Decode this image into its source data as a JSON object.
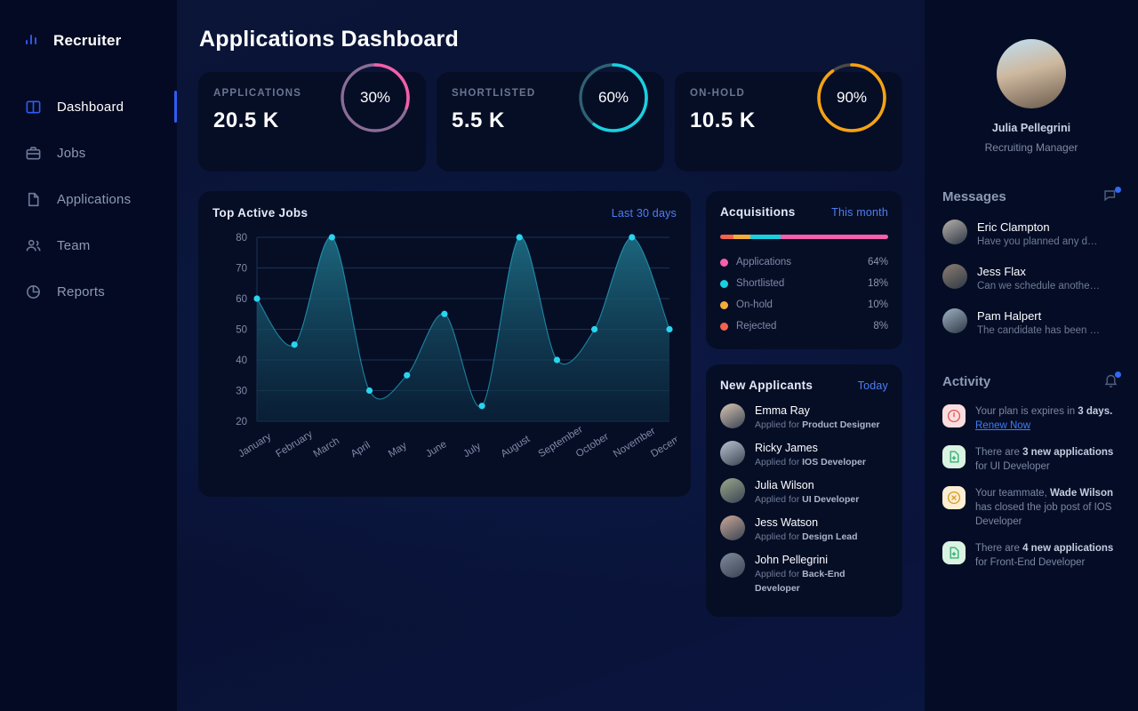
{
  "sidebar": {
    "brand": {
      "label": "Recruiter",
      "icon": "bar-chart-icon"
    },
    "items": [
      {
        "label": "Dashboard",
        "icon": "dashboard-icon",
        "active": true
      },
      {
        "label": "Jobs",
        "icon": "briefcase-icon",
        "active": false
      },
      {
        "label": "Applications",
        "icon": "document-icon",
        "active": false
      },
      {
        "label": "Team",
        "icon": "users-icon",
        "active": false
      },
      {
        "label": "Reports",
        "icon": "pie-chart-icon",
        "active": false
      }
    ]
  },
  "header": {
    "title": "Applications Dashboard"
  },
  "stats": [
    {
      "label": "APPLICATIONS",
      "value": "20.5 K",
      "percent_label": "30%",
      "percent": 30,
      "color": "#f25fa8",
      "track": "#8a6d96"
    },
    {
      "label": "SHORTLISTED",
      "value": "5.5 K",
      "percent_label": "60%",
      "percent": 60,
      "color": "#1ad0e0",
      "track": "#2d6273"
    },
    {
      "label": "ON-HOLD",
      "value": "10.5 K",
      "percent_label": "90%",
      "percent": 90,
      "color": "#f5a213",
      "track": "#4a4a46"
    }
  ],
  "chart_panel": {
    "title": "Top Active Jobs",
    "action": "Last 30 days"
  },
  "chart_data": {
    "type": "area",
    "title": "Top Active Jobs",
    "xlabel": "",
    "ylabel": "",
    "categories": [
      "January",
      "February",
      "March",
      "April",
      "May",
      "June",
      "July",
      "August",
      "September",
      "October",
      "November",
      "December"
    ],
    "values": [
      60,
      45,
      80,
      30,
      35,
      55,
      25,
      80,
      40,
      50,
      80,
      50
    ],
    "yticks": [
      20,
      30,
      40,
      50,
      60,
      70,
      80
    ],
    "ylim": [
      20,
      80
    ],
    "grid": true,
    "legend": "none",
    "line_color": "#2ad4f0",
    "point_color": "#2ad4f0",
    "fill_top": "#1d6b82",
    "fill_bottom": "#0c2c42"
  },
  "acquisitions": {
    "title": "Acquisitions",
    "action": "This month",
    "segments": [
      {
        "label": "Rejected",
        "percent": 8,
        "color": "#f2624f"
      },
      {
        "label": "On-hold",
        "percent": 10,
        "color": "#f5ac3a"
      },
      {
        "label": "Shortlisted",
        "percent": 18,
        "color": "#1ad0e0"
      },
      {
        "label": "Applications",
        "percent": 64,
        "color": "#f660ae"
      }
    ],
    "rows": [
      {
        "label": "Applications",
        "value": "64%",
        "color": "#f660ae"
      },
      {
        "label": "Shortlisted",
        "value": "18%",
        "color": "#1ad0e0"
      },
      {
        "label": "On-hold",
        "value": "10%",
        "color": "#f5ac3a"
      },
      {
        "label": "Rejected",
        "value": "8%",
        "color": "#f2624f"
      }
    ]
  },
  "new_applicants": {
    "title": "New Applicants",
    "action": "Today",
    "items": [
      {
        "name": "Emma Ray",
        "applied_prefix": "Applied for ",
        "role": "Product Designer",
        "avatar": "#d8c6b4"
      },
      {
        "name": "Ricky James",
        "applied_prefix": "Applied for ",
        "role": "IOS Developer",
        "avatar": "#b9c4d2"
      },
      {
        "name": "Julia Wilson",
        "applied_prefix": "Applied for ",
        "role": "UI Developer",
        "avatar": "#9aa88c"
      },
      {
        "name": "Jess Watson",
        "applied_prefix": "Applied for ",
        "role": "Design Lead",
        "avatar": "#caa896"
      },
      {
        "name": "John Pellegrini",
        "applied_prefix": "Applied for ",
        "role": "Back-End Developer",
        "avatar": "#7f8b9c"
      }
    ]
  },
  "profile": {
    "name": "Julia Pellegrini",
    "role": "Recruiting Manager",
    "avatar": "#cdb89e"
  },
  "messages": {
    "title": "Messages",
    "icon": "chat-bubble-icon",
    "items": [
      {
        "name": "Eric Clampton",
        "preview": "Have you planned any d…",
        "avatar": "#b7b2ac"
      },
      {
        "name": "Jess Flax",
        "preview": "Can we schedule anothe…",
        "avatar": "#8d7f73"
      },
      {
        "name": "Pam Halpert",
        "preview": "The candidate has been …",
        "avatar": "#9fb2c4"
      }
    ]
  },
  "activity": {
    "title": "Activity",
    "icon": "bell-icon",
    "items": [
      {
        "icon": "alert-circle-icon",
        "icon_bg": "#fadde0",
        "icon_color": "#e0534f",
        "parts": [
          {
            "text": "Your plan is expires in ",
            "style": "normal"
          },
          {
            "text": "3 days.",
            "style": "bold"
          }
        ],
        "link": "Renew Now"
      },
      {
        "icon": "file-plus-icon",
        "icon_bg": "#d9f3e3",
        "icon_color": "#2faa6c",
        "parts": [
          {
            "text": "There are ",
            "style": "normal"
          },
          {
            "text": "3 new applications",
            "style": "bold"
          },
          {
            "text": " for UI Developer",
            "style": "normal"
          }
        ],
        "link": ""
      },
      {
        "icon": "close-circle-icon",
        "icon_bg": "#fbeed3",
        "icon_color": "#d69a22",
        "parts": [
          {
            "text": "Your teammate, ",
            "style": "normal"
          },
          {
            "text": "Wade Wilson",
            "style": "bold"
          },
          {
            "text": " has closed the job post of IOS Developer",
            "style": "normal"
          }
        ],
        "link": ""
      },
      {
        "icon": "file-plus-icon",
        "icon_bg": "#d9f3e3",
        "icon_color": "#2faa6c",
        "parts": [
          {
            "text": "There are ",
            "style": "normal"
          },
          {
            "text": "4 new applications",
            "style": "bold"
          },
          {
            "text": " for Front-End Developer",
            "style": "normal"
          }
        ],
        "link": ""
      }
    ]
  }
}
